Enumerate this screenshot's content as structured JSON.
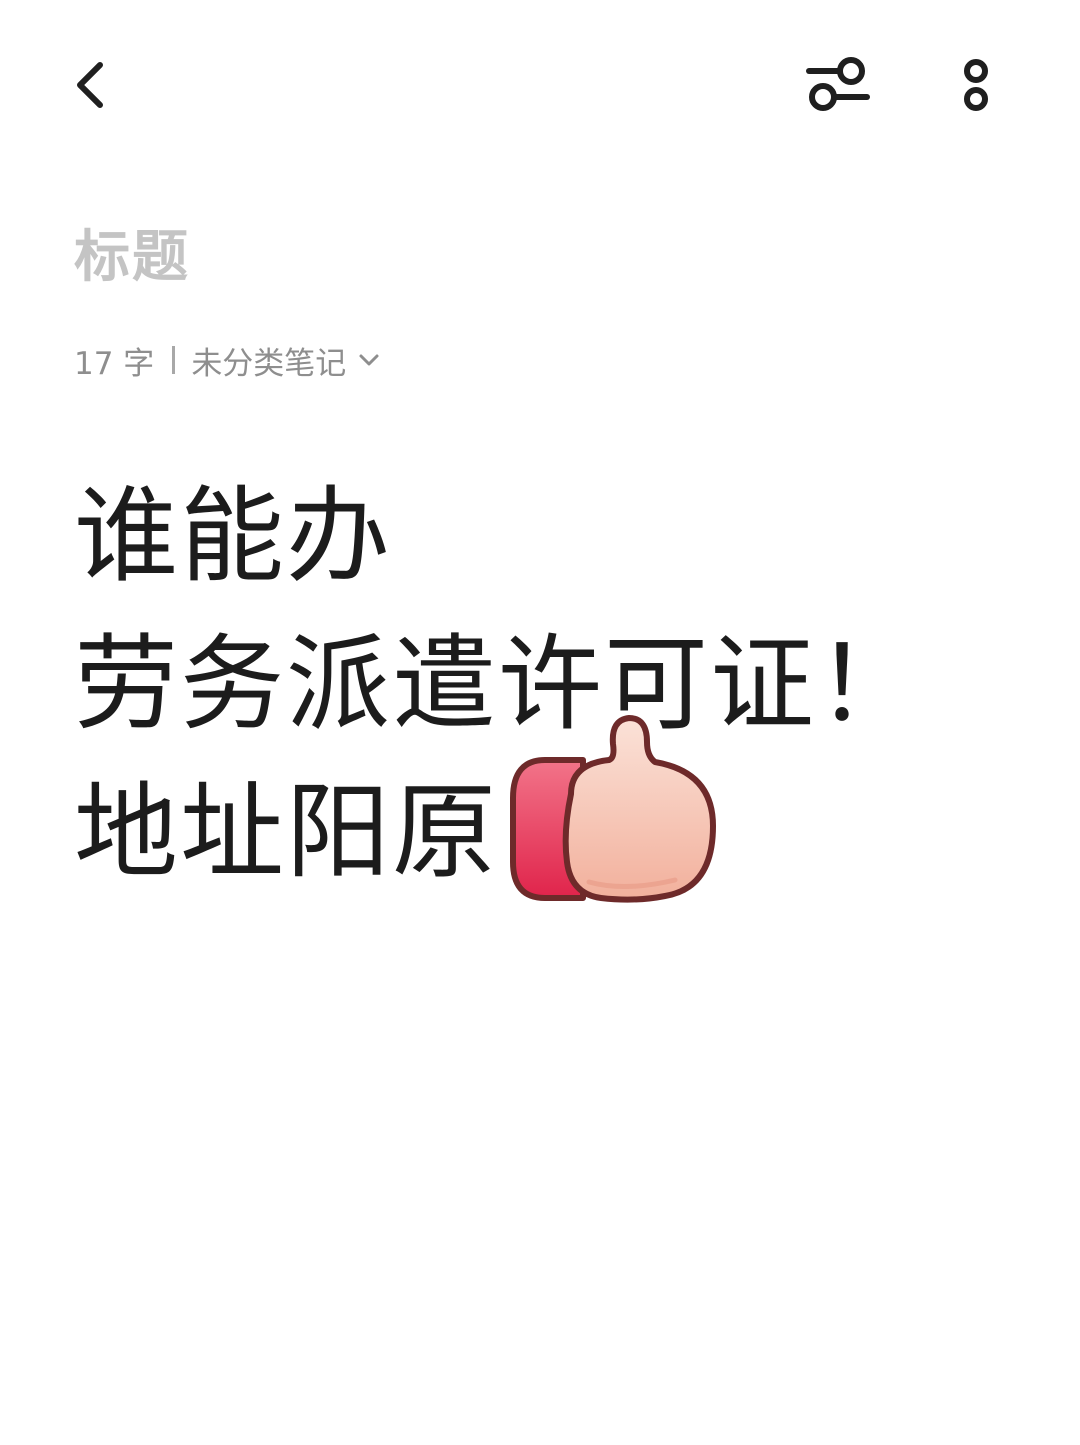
{
  "toolbar": {
    "back_icon": "chevron-left-icon",
    "filter_icon": "sliders-icon",
    "more_icon": "more-vertical-icon"
  },
  "note": {
    "title_placeholder": "标题",
    "word_count": "17 字",
    "category": "未分类笔记",
    "lines": [
      "谁能办",
      "劳务派遣许可证！",
      "地址阳原"
    ],
    "emoji": "thumbs-up-emoji"
  },
  "colors": {
    "background": "#ffffff",
    "text": "#1c1c1c",
    "placeholder": "#c4c4c4",
    "meta": "#8e8e8e",
    "thumb_sleeve": "#e8445e",
    "thumb_hand": "#f6c4b3"
  }
}
